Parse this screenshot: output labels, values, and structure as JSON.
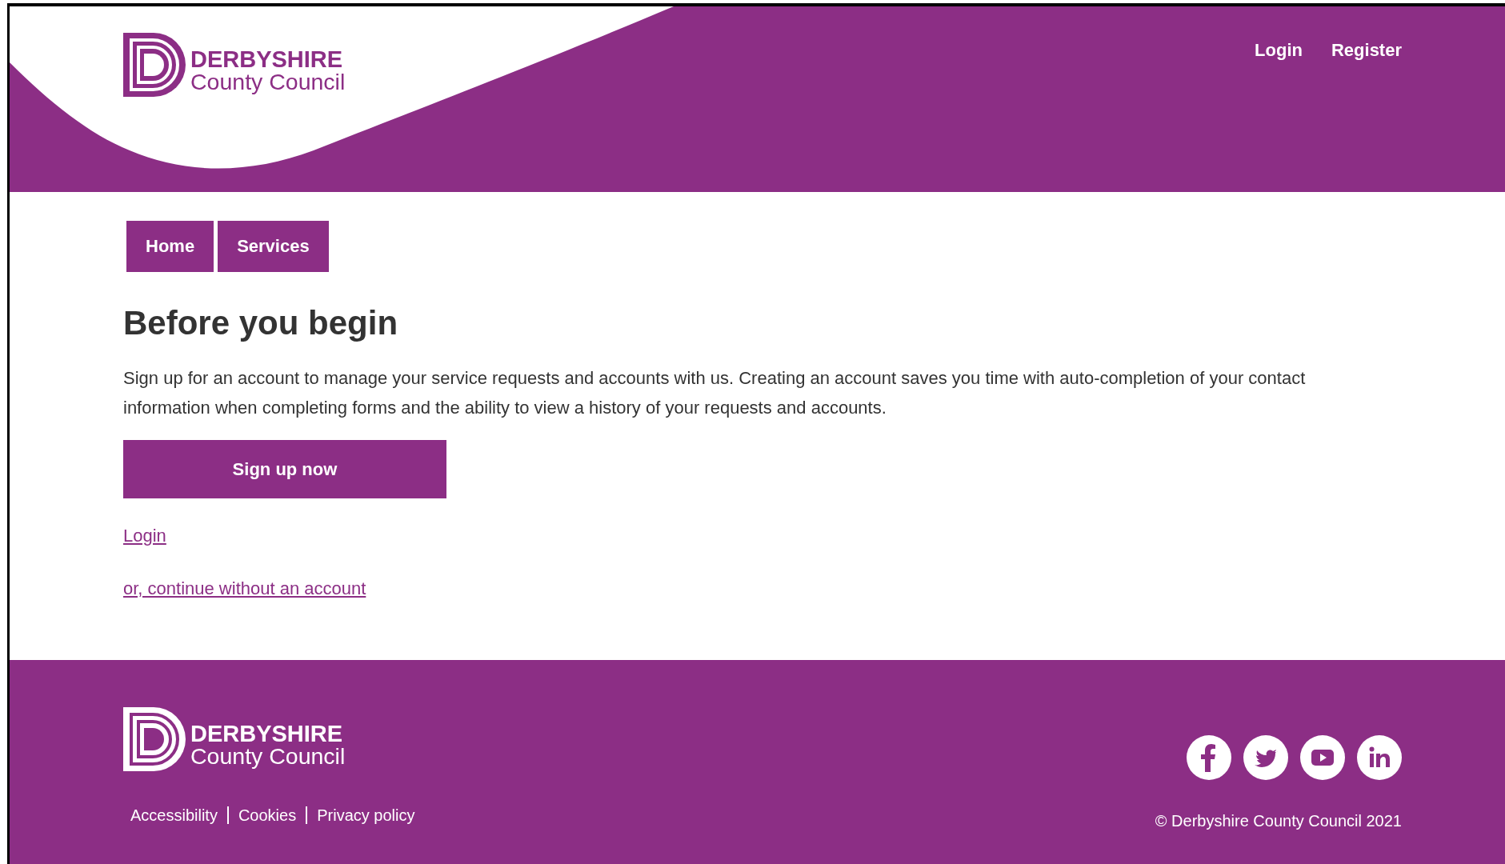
{
  "header": {
    "logo": {
      "line_1": "DERBYSHIRE",
      "line_2": "County Council"
    },
    "links": [
      "Login",
      "Register"
    ]
  },
  "nav": [
    {
      "label": "Home"
    },
    {
      "label": "Services"
    }
  ],
  "main": {
    "heading": "Before you begin",
    "intro": "Sign up for an account to manage your service requests and accounts with us. Creating an account saves you time with auto-completion of your contact information when completing forms and the ability to view a history of your requests and accounts.",
    "primary_button": "Sign up now",
    "links": [
      "Login",
      "or, continue without an account"
    ]
  },
  "footer": {
    "logo": {
      "line_1": "DERBYSHIRE",
      "line_2": "County Council"
    },
    "links": [
      "Accessibility",
      "Cookies",
      "Privacy policy"
    ],
    "social": [
      {
        "kind": "facebook"
      },
      {
        "kind": "twitter"
      },
      {
        "kind": "youtube"
      },
      {
        "kind": "linkedin"
      }
    ],
    "copyright": "© Derbyshire County Council 2021"
  }
}
